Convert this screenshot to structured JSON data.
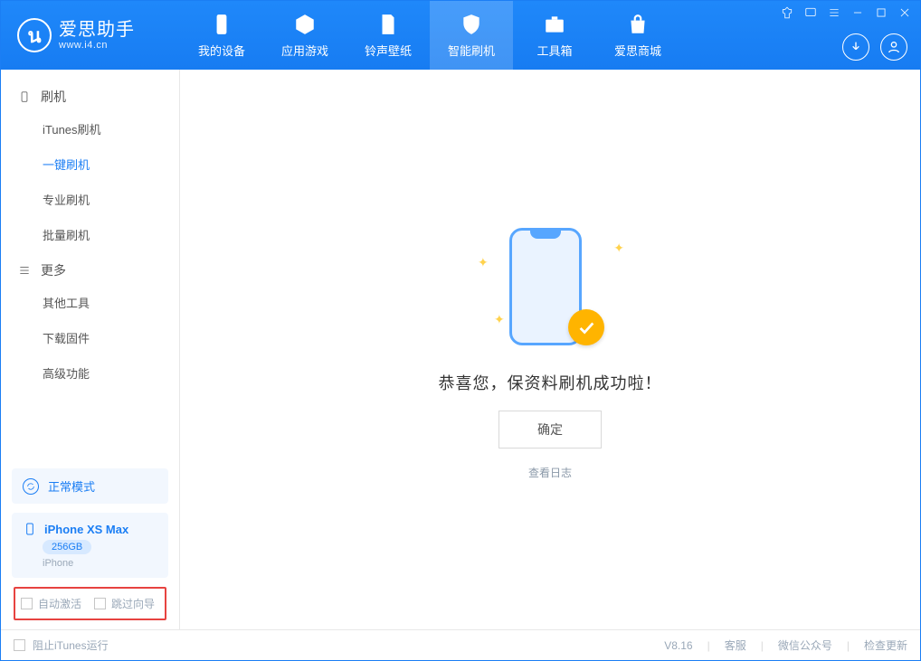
{
  "brand": {
    "title": "爱思助手",
    "subtitle": "www.i4.cn",
    "logo_letter": "น"
  },
  "tabs": [
    {
      "label": "我的设备"
    },
    {
      "label": "应用游戏"
    },
    {
      "label": "铃声壁纸"
    },
    {
      "label": "智能刷机"
    },
    {
      "label": "工具箱"
    },
    {
      "label": "爱思商城"
    }
  ],
  "active_tab_index": 3,
  "sidebar": {
    "sections": [
      {
        "title": "刷机",
        "items": [
          "iTunes刷机",
          "一键刷机",
          "专业刷机",
          "批量刷机"
        ],
        "active_index": 1
      },
      {
        "title": "更多",
        "items": [
          "其他工具",
          "下载固件",
          "高级功能"
        ],
        "active_index": -1
      }
    ],
    "mode": {
      "label": "正常模式"
    },
    "device": {
      "name": "iPhone XS Max",
      "storage": "256GB",
      "type": "iPhone"
    },
    "options": [
      {
        "label": "自动激活",
        "checked": false
      },
      {
        "label": "跳过向导",
        "checked": false
      }
    ]
  },
  "main": {
    "message": "恭喜您，保资料刷机成功啦！",
    "ok_label": "确定",
    "log_link": "查看日志"
  },
  "footer": {
    "block_itunes": "阻止iTunes运行",
    "version": "V8.16",
    "links": [
      "客服",
      "微信公众号",
      "检查更新"
    ]
  }
}
